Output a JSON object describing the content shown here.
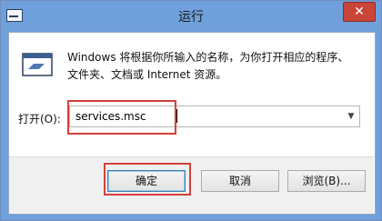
{
  "window": {
    "title": "运行",
    "close_glyph": "✕"
  },
  "content": {
    "description_line1": "Windows 将根据你所输入的名称，为你打开相应的程序、",
    "description_line2": "文件夹、文档或 Internet 资源。",
    "open_label": "打开(O):",
    "input_value": "services.msc"
  },
  "buttons": {
    "ok": "确定",
    "cancel": "取消",
    "browse": "浏览(B)..."
  },
  "icons": {
    "app": "run-app-icon",
    "run": "run-dialog-icon",
    "dropdown": "chevron-down-icon"
  },
  "colors": {
    "highlight": "#d5403a",
    "titlebar": "#6fa0dc",
    "close": "#c9453a"
  }
}
